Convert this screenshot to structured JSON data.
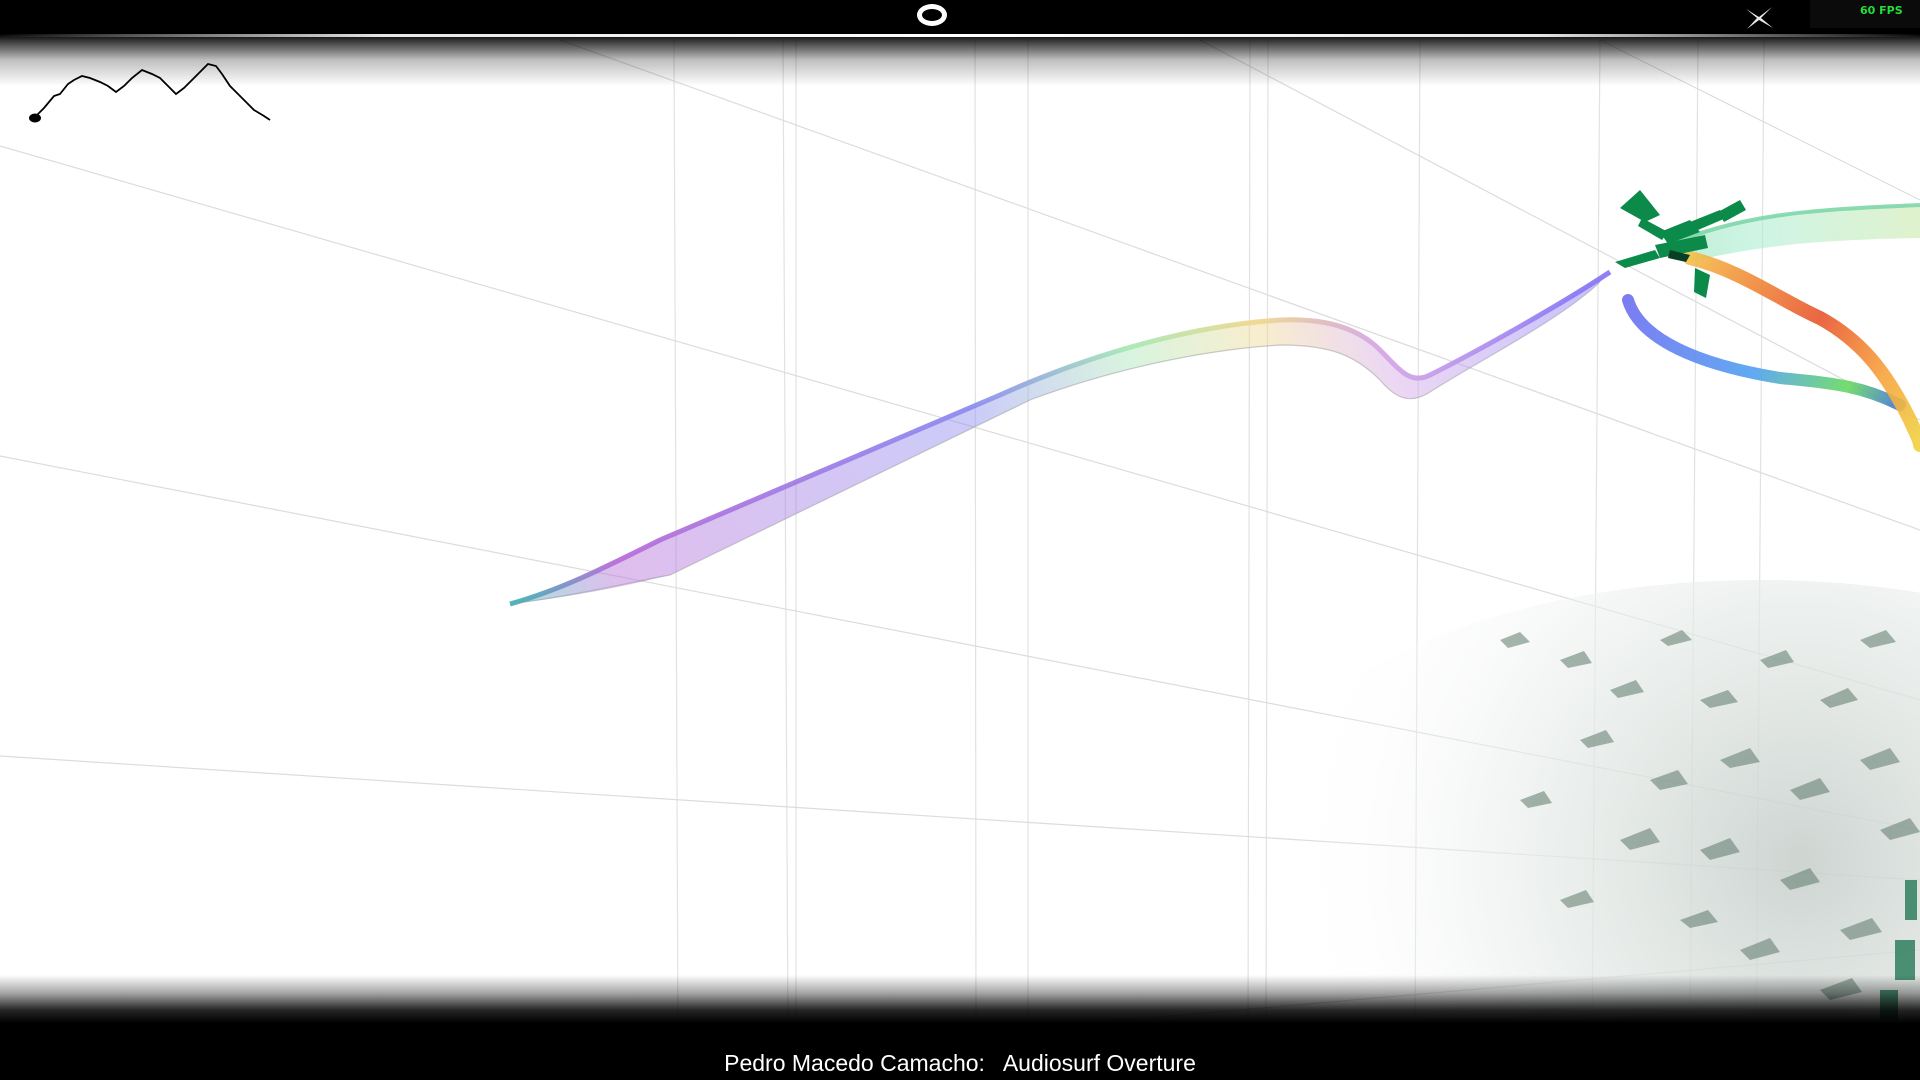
{
  "hud": {
    "fps_text": "60 FPS",
    "mode_icon": "ring-icon",
    "exit_icon": "x-icon"
  },
  "now_playing": {
    "artist": "Pedro Macedo Camacho:",
    "separator": "   ",
    "title": "Audiosurf Overture"
  },
  "colors": {
    "background": "#ffffff",
    "bars": "#000000",
    "fps": "#22e03a",
    "ship": "#0c8a4a",
    "blocks": "#5e7a6c"
  },
  "track": {
    "description_icon": "rainbow-track",
    "minimap_icon": "elevation-minimap"
  }
}
